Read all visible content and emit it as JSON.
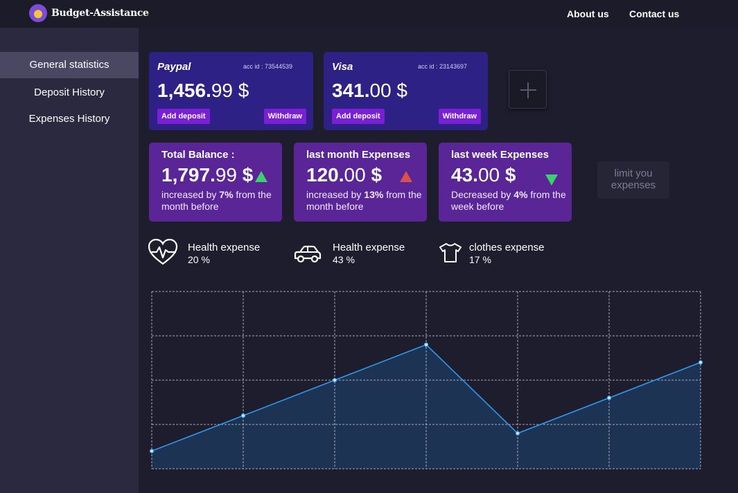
{
  "app": {
    "brand": "Budget-Assistance",
    "logo_icon": "piggy-logo-icon"
  },
  "nav": {
    "about": "About us",
    "contact": "Contact us"
  },
  "sidebar": {
    "items": [
      {
        "label": "General statistics",
        "active": true
      },
      {
        "label": "Deposit History",
        "active": false
      },
      {
        "label": "Expenses History",
        "active": false
      }
    ]
  },
  "accounts": [
    {
      "name": "Paypal",
      "acc_id": "acc id :  73544539",
      "amount_int": "1,456.",
      "amount_dec": "99 $",
      "deposit_label": "Add deposit",
      "withdraw_label": "Withdraw"
    },
    {
      "name": "Visa",
      "acc_id": "acc id :  23143697",
      "amount_int": "341.",
      "amount_dec": "00 $",
      "deposit_label": "Add deposit",
      "withdraw_label": "Withdraw"
    }
  ],
  "add_account_icon": "plus-icon",
  "stats": [
    {
      "title": "Total Balance :",
      "amount_int": "1,797.",
      "amount_dec": "99",
      "currency": "$",
      "trend": "up",
      "trend_color": "#3ecf6e",
      "desc_pre": "increased by ",
      "desc_pct": "7%",
      "desc_post": " from the month before"
    },
    {
      "title": "last month Expenses",
      "amount_int": "120.",
      "amount_dec": "00",
      "currency": "$",
      "trend": "up",
      "trend_color": "#d9524a",
      "desc_pre": "increased by ",
      "desc_pct": "13%",
      "desc_post": " from the month before"
    },
    {
      "title": "last week Expenses",
      "amount_int": "43.",
      "amount_dec": "00",
      "currency": "$",
      "trend": "down",
      "trend_color": "#3ecf6e",
      "desc_pre": "Decreased by ",
      "desc_pct": "4%",
      "desc_post": " from the week before"
    }
  ],
  "limit_button": "limit you expenses",
  "categories": [
    {
      "icon": "heart-pulse-icon",
      "label": "Health expense",
      "percent": "20 %"
    },
    {
      "icon": "car-icon",
      "label": "Health expense",
      "percent": "43 %"
    },
    {
      "icon": "tshirt-icon",
      "label": "clothes expense",
      "percent": "17 %"
    }
  ],
  "colors": {
    "accent": "#2f9bf0",
    "account_card": "#2e2185",
    "stat_card": "#5a2597",
    "button": "#7b1fd6"
  },
  "chart_data": {
    "type": "area",
    "title": "",
    "x": [
      0,
      1,
      2,
      3,
      4,
      5,
      6
    ],
    "values": [
      0.4,
      1.2,
      2.0,
      2.8,
      0.8,
      1.6,
      2.4
    ],
    "ylim": [
      0,
      4
    ],
    "grid": true,
    "line_color": "#2f9bf0",
    "fill_color": "#1c3354"
  }
}
